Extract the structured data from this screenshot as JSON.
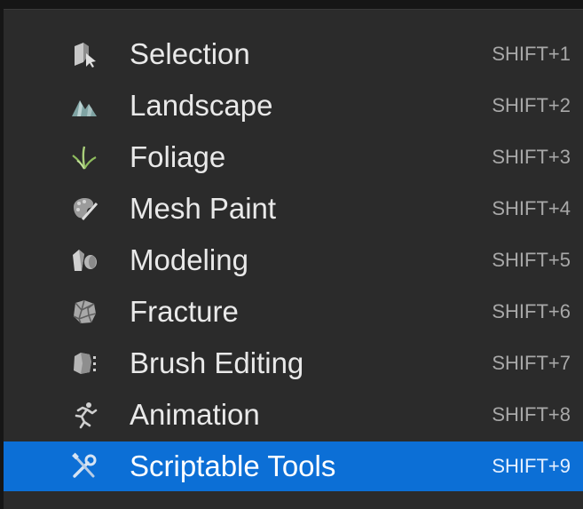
{
  "menu": {
    "items": [
      {
        "label": "Selection",
        "shortcut": "SHIFT+1",
        "icon": "selection-icon"
      },
      {
        "label": "Landscape",
        "shortcut": "SHIFT+2",
        "icon": "landscape-icon"
      },
      {
        "label": "Foliage",
        "shortcut": "SHIFT+3",
        "icon": "foliage-icon"
      },
      {
        "label": "Mesh Paint",
        "shortcut": "SHIFT+4",
        "icon": "mesh-paint-icon"
      },
      {
        "label": "Modeling",
        "shortcut": "SHIFT+5",
        "icon": "modeling-icon"
      },
      {
        "label": "Fracture",
        "shortcut": "SHIFT+6",
        "icon": "fracture-icon"
      },
      {
        "label": "Brush Editing",
        "shortcut": "SHIFT+7",
        "icon": "brush-editing-icon"
      },
      {
        "label": "Animation",
        "shortcut": "SHIFT+8",
        "icon": "animation-icon"
      },
      {
        "label": "Scriptable Tools",
        "shortcut": "SHIFT+9",
        "icon": "scriptable-tools-icon",
        "highlighted": true
      }
    ]
  },
  "colors": {
    "background": "#2b2b2b",
    "highlight": "#0c6fd6",
    "label": "#e9e9e9",
    "shortcut": "#a8a8a8"
  }
}
